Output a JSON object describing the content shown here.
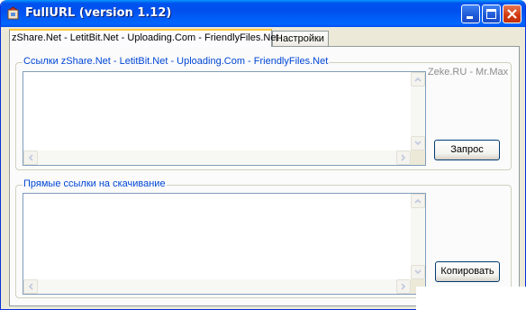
{
  "window": {
    "title": "FullURL (version 1.12)",
    "app_icon": "app-icon",
    "controls": {
      "minimize_icon": "minimize-icon",
      "maximize_icon": "maximize-icon",
      "close_icon": "close-icon"
    }
  },
  "tabs": [
    {
      "label": "zShare.Net - LetitBit.Net - Uploading.Com - FriendlyFiles.Net",
      "active": true
    },
    {
      "label": "Настройки",
      "active": false
    }
  ],
  "links_group": {
    "legend": "Ссылки zShare.Net - LetitBit.Net - Uploading.Com - FriendlyFiles.Net",
    "text": ""
  },
  "credit": "Zeke.RU - Mr.Max",
  "request_button": "Запрос",
  "direct_group": {
    "legend": "Прямые ссылки на скачивание",
    "text": ""
  },
  "copy_button": "Копировать",
  "colors": {
    "title_bar": "#0054e3",
    "legend_text": "#0046d5",
    "close_button": "#d2380f",
    "tab_highlight": "#ffc83c"
  }
}
